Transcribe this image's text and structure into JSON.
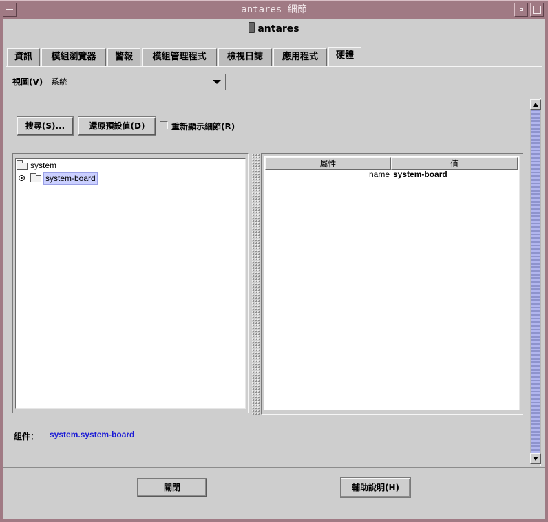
{
  "window": {
    "title": "antares 細節"
  },
  "header": {
    "host": "antares",
    "host_icon": "server-icon"
  },
  "tabs": [
    "資訊",
    "模組瀏覽器",
    "警報",
    "模組管理程式",
    "檢視日誌",
    "應用程式",
    "硬體"
  ],
  "active_tab": "硬體",
  "view": {
    "label": "視圖(V)",
    "value": "系統"
  },
  "toolbar": {
    "search": "搜尋(S)...",
    "restore": "還原預設值(D)",
    "redisplay": "重新顯示細節(R)"
  },
  "tree": {
    "items": [
      {
        "label": "system"
      },
      {
        "label": "system-board"
      }
    ]
  },
  "table": {
    "headers": [
      "屬性",
      "值"
    ],
    "rows": [
      {
        "attr": "name",
        "value": "system-board"
      }
    ]
  },
  "component": {
    "label": "組件：",
    "value": "system.system-board"
  },
  "footer": {
    "close": "關閉",
    "help": "輔助說明(H)"
  },
  "colors": {
    "titlebar": "#a07a84",
    "selection": "#cbd0ff",
    "link": "#1a1ad6"
  }
}
